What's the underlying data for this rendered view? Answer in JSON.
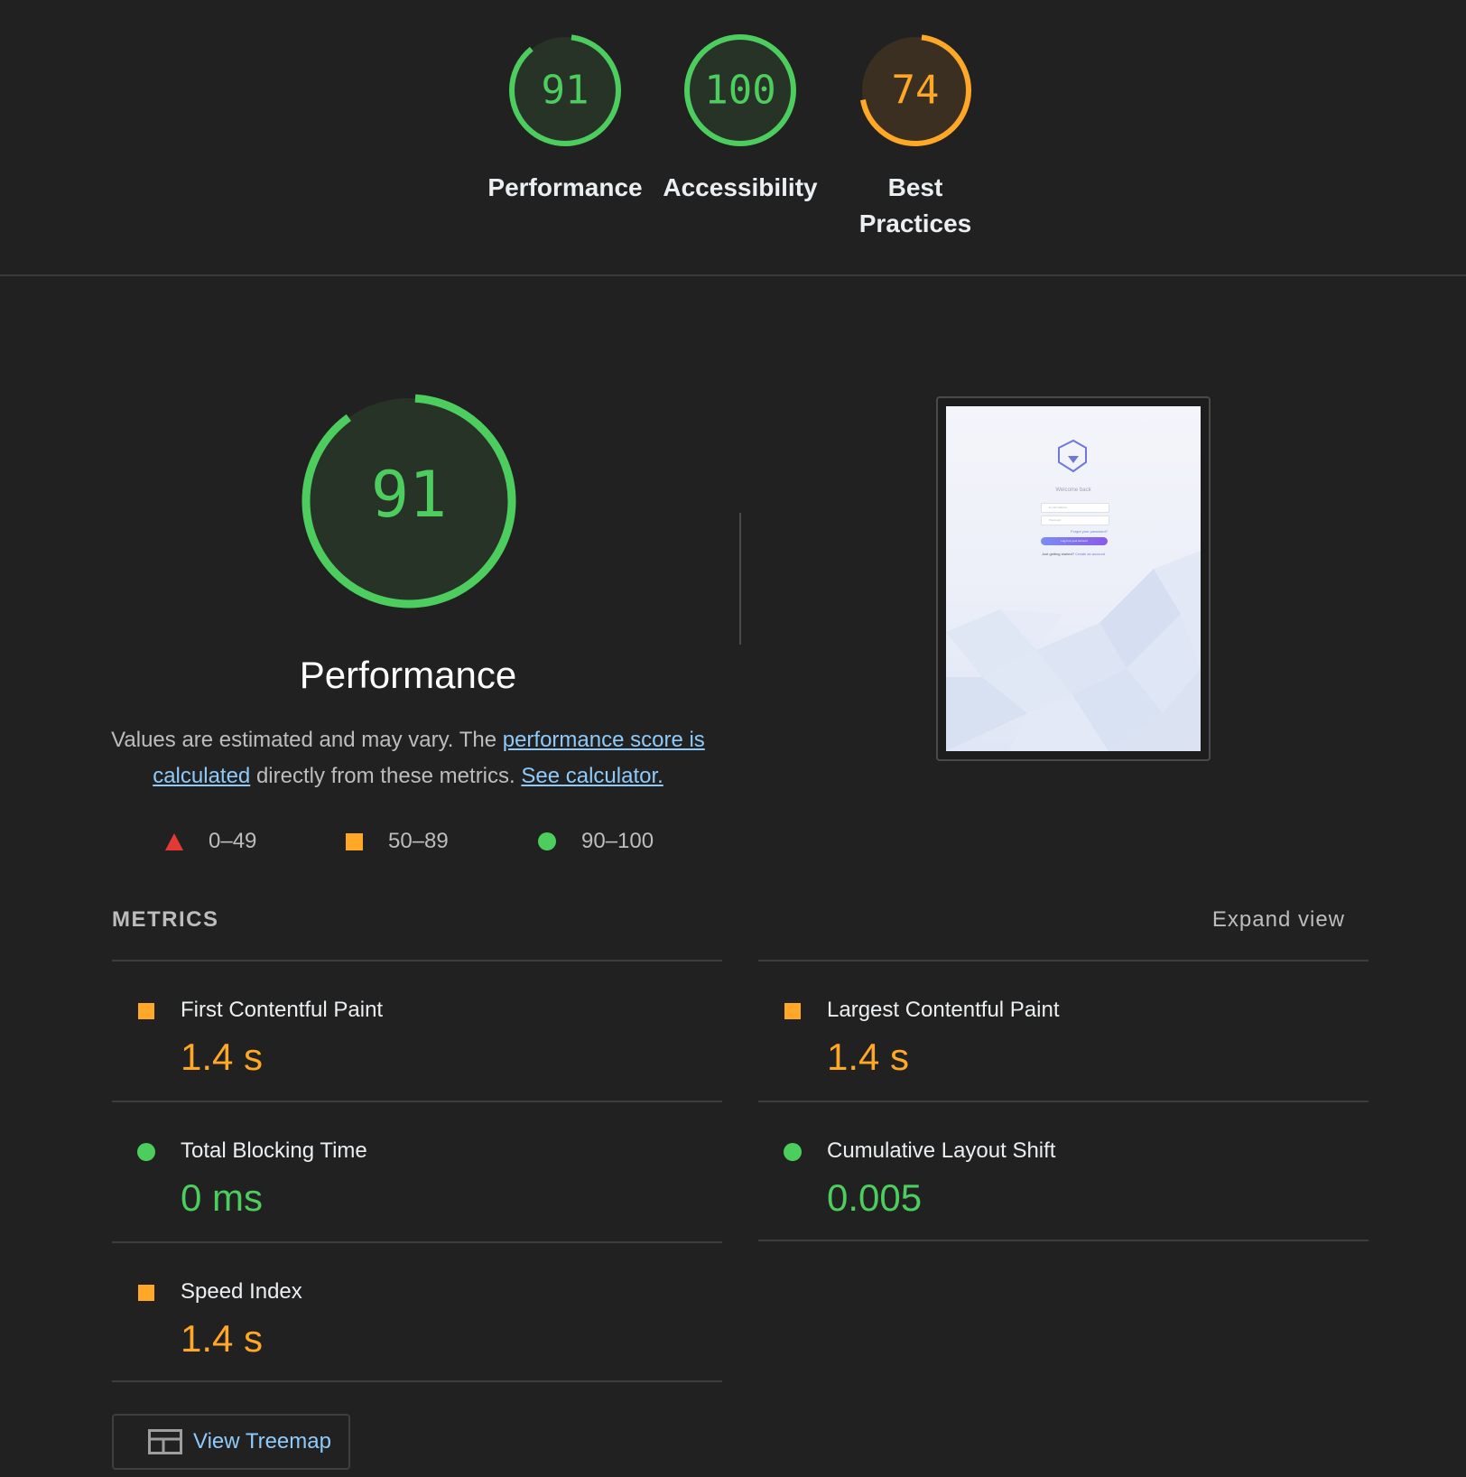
{
  "categories": [
    {
      "label": "Performance",
      "score": 91,
      "status": "pass"
    },
    {
      "label": "Accessibility",
      "score": 100,
      "status": "pass"
    },
    {
      "label": "Best Practices",
      "score": 74,
      "status": "average"
    }
  ],
  "main": {
    "score": 91,
    "title": "Performance",
    "description": {
      "part1": "Values are estimated and may vary. The ",
      "link1": "performance score is calculated",
      "part2": " directly from these metrics. ",
      "link2": "See calculator."
    }
  },
  "legend": {
    "fail": "0–49",
    "average": "50–89",
    "pass": "90–100"
  },
  "thumbnail": {
    "welcome": "Welcome back",
    "email_placeholder": "E-mail address",
    "password_placeholder": "Password",
    "forgot": "Forgot your password?",
    "login_button": "Log in to your account",
    "footer_prefix": "Just getting started? ",
    "footer_link": "Create an account"
  },
  "metrics": {
    "header": "METRICS",
    "expand": "Expand view",
    "items": [
      {
        "label": "First Contentful Paint",
        "value": "1.4 s",
        "status": "average"
      },
      {
        "label": "Largest Contentful Paint",
        "value": "1.4 s",
        "status": "average"
      },
      {
        "label": "Total Blocking Time",
        "value": "0 ms",
        "status": "pass"
      },
      {
        "label": "Cumulative Layout Shift",
        "value": "0.005",
        "status": "pass"
      },
      {
        "label": "Speed Index",
        "value": "1.4 s",
        "status": "average"
      }
    ]
  },
  "treemap_button": "View Treemap",
  "colors": {
    "pass": "#4ccd5e",
    "average": "#ffa726",
    "fail": "#e53935",
    "link": "#90caf9",
    "background": "#212121"
  }
}
